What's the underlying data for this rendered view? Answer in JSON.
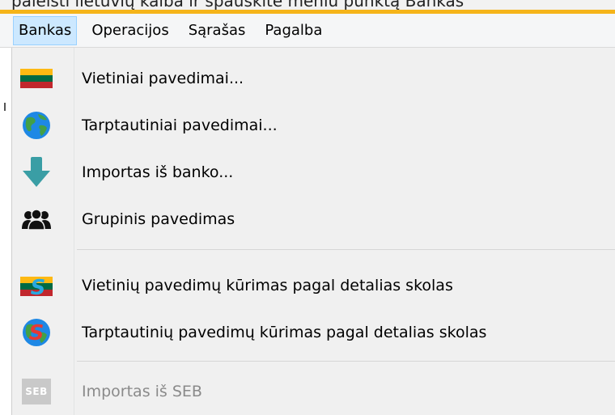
{
  "window": {
    "title_partial": "paleisti lietuvių kalba ir spauskite meniu punktą Bankas"
  },
  "menubar": {
    "items": [
      {
        "label": "Bankas",
        "active": true
      },
      {
        "label": "Operacijos",
        "active": false
      },
      {
        "label": "Sąrašas",
        "active": false
      },
      {
        "label": "Pagalba",
        "active": false
      }
    ]
  },
  "dropdown": {
    "items": [
      {
        "label": "Vietiniai pavedimai...",
        "icon": "lithuania-flag-icon",
        "enabled": true
      },
      {
        "label": "Tarptautiniai pavedimai...",
        "icon": "globe-icon",
        "enabled": true
      },
      {
        "label": "Importas iš banko...",
        "icon": "arrow-down-icon",
        "enabled": true
      },
      {
        "label": "Grupinis pavedimas",
        "icon": "group-people-icon",
        "enabled": true
      },
      {
        "label": "Vietinių pavedimų kūrimas pagal detalias skolas",
        "icon": "lithuania-flag-s-icon",
        "enabled": true
      },
      {
        "label": "Tarptautinių pavedimų kūrimas pagal detalias skolas",
        "icon": "globe-s-icon",
        "enabled": true
      },
      {
        "label": "Importas iš SEB",
        "icon": "seb-logo-icon",
        "enabled": false
      }
    ],
    "seb_logo_text": "SEB"
  },
  "colors": {
    "accent_strip": "#f5b41a",
    "menubar_active_bg": "#cce8ff",
    "menubar_active_border": "#99d1ff",
    "menu_bg": "#f0f0f0",
    "disabled_text": "#8a8a8a",
    "flag_yellow": "#fdb913",
    "flag_green": "#006a44",
    "flag_red": "#c1272d"
  }
}
